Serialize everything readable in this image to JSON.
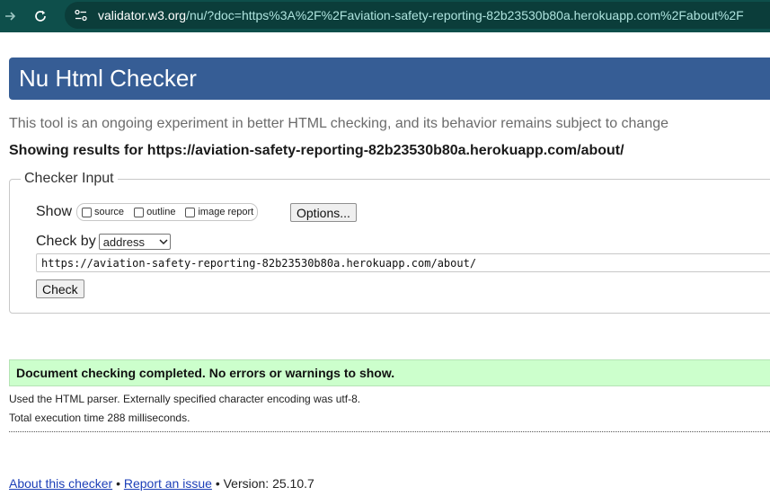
{
  "browser": {
    "url_host": "validator.w3.org",
    "url_rest": "/nu/?doc=https%3A%2F%2Faviation-safety-reporting-82b23530b80a.herokuapp.com%2Fabout%2F",
    "forward_icon": "arrow-right-icon",
    "reload_icon": "reload-icon",
    "site_info_icon": "site-settings-icon"
  },
  "header": {
    "title": "Nu Html Checker",
    "bg_color": "#365d95"
  },
  "tagline": "This tool is an ongoing experiment in better HTML checking, and its behavior remains subject to change",
  "results_for": "Showing results for https://aviation-safety-reporting-82b23530b80a.herokuapp.com/about/",
  "checker_input": {
    "legend": "Checker Input",
    "show_label": "Show",
    "show_options": [
      {
        "label": "source",
        "checked": false
      },
      {
        "label": "outline",
        "checked": false
      },
      {
        "label": "image report",
        "checked": false
      }
    ],
    "options_button": "Options...",
    "check_by_label": "Check by",
    "check_by_value": "address",
    "url_value": "https://aviation-safety-reporting-82b23530b80a.herokuapp.com/about/",
    "check_button": "Check"
  },
  "result": {
    "message": "Document checking completed. No errors or warnings to show.",
    "bg_color": "#ccffcc",
    "parser_info": "Used the HTML parser. Externally specified character encoding was utf-8.",
    "execution_time": "Total execution time 288 milliseconds."
  },
  "footer": {
    "about_link": "About this checker",
    "separator": "•",
    "report_link": "Report an issue",
    "version": "Version: 25.10.7"
  }
}
